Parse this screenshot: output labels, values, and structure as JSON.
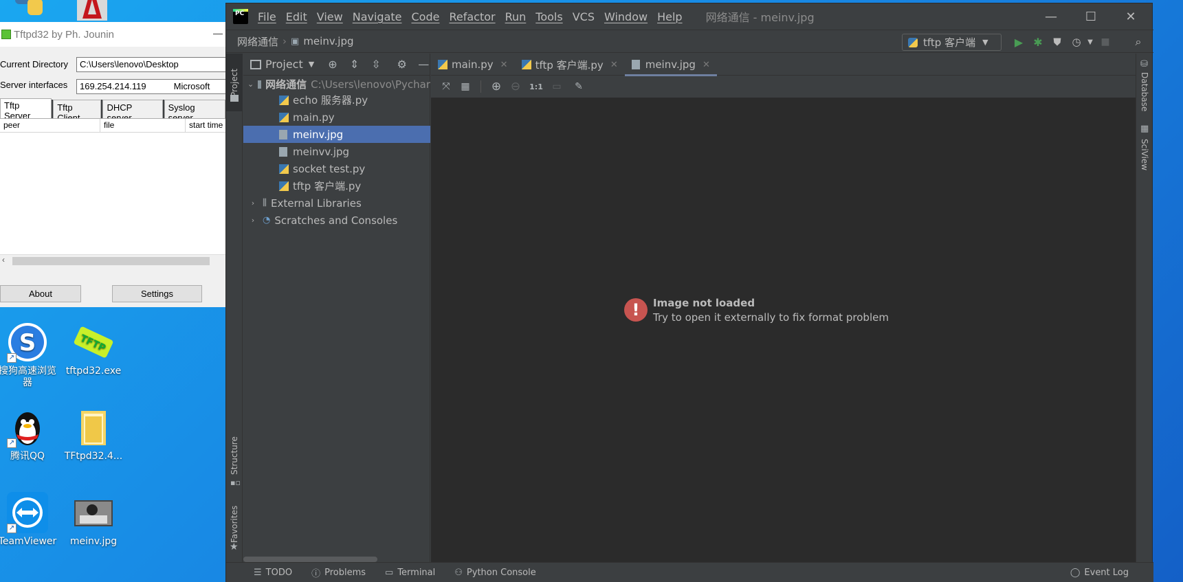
{
  "desktop": {
    "icons": [
      {
        "label": "搜狗高速浏览器",
        "name": "sogou"
      },
      {
        "label": "tftpd32.exe",
        "name": "tftpd"
      },
      {
        "label": "腾讯QQ",
        "name": "qq"
      },
      {
        "label": "TFtpd32.4...",
        "name": "folder"
      },
      {
        "label": "TeamViewer",
        "name": "teamviewer"
      },
      {
        "label": "meinv.jpg",
        "name": "photo"
      }
    ]
  },
  "tftpd": {
    "title": "Tftpd32 by Ph. Jounin",
    "current_directory_label": "Current Directory",
    "current_directory_value": "C:\\Users\\lenovo\\Desktop",
    "server_interfaces_label": "Server interfaces",
    "server_interfaces_value": "169.254.214.119",
    "server_interfaces_adapter": "Microsoft",
    "tabs": [
      "Tftp Server",
      "Tftp Client",
      "DHCP server",
      "Syslog server"
    ],
    "columns": [
      "peer",
      "file",
      "start time"
    ],
    "about_label": "About",
    "settings_label": "Settings"
  },
  "ide": {
    "menu": [
      "File",
      "Edit",
      "View",
      "Navigate",
      "Code",
      "Refactor",
      "Run",
      "Tools",
      "VCS",
      "Window",
      "Help"
    ],
    "window_title": "网络通信 - meinv.jpg",
    "breadcrumb": [
      "网络通信",
      "meinv.jpg"
    ],
    "run_config": "tftp 客户端",
    "project_label": "Project",
    "tree": {
      "root": "网络通信",
      "root_path": "C:\\Users\\lenovo\\Pychar",
      "files": [
        "echo 服务器.py",
        "main.py",
        "meinv.jpg",
        "meinvv.jpg",
        "socket test.py",
        "tftp 客户端.py"
      ],
      "external": "External Libraries",
      "scratches": "Scratches and Consoles"
    },
    "tabs": [
      "main.py",
      "tftp 客户端.py",
      "meinv.jpg"
    ],
    "image_zoom_label": "1:1",
    "error_title": "Image not loaded",
    "error_subtitle": "Try to open it externally to fix format problem",
    "left_tabs": {
      "project": "Project",
      "structure": "Structure",
      "favorites": "Favorites"
    },
    "right_tabs": {
      "database": "Database",
      "sciview": "SciView"
    },
    "status": {
      "todo": "TODO",
      "problems": "Problems",
      "terminal": "Terminal",
      "python_console": "Python Console",
      "event_log": "Event Log"
    },
    "colors": {
      "selection": "#4b6eaf",
      "error": "#c75450",
      "run": "#499c54"
    }
  }
}
